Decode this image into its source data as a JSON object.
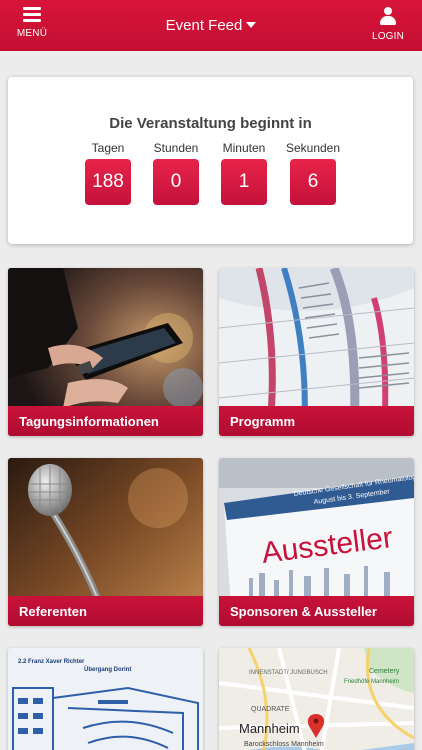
{
  "header": {
    "menu_label": "MENÜ",
    "title": "Event Feed",
    "login_label": "LOGIN"
  },
  "countdown": {
    "title": "Die Veranstaltung beginnt in",
    "units": [
      {
        "label": "Tagen",
        "value": "188"
      },
      {
        "label": "Stunden",
        "value": "0"
      },
      {
        "label": "Minuten",
        "value": "1"
      },
      {
        "label": "Sekunden",
        "value": "6"
      }
    ]
  },
  "tiles": [
    {
      "label": "Tagungsinformationen",
      "icon": "tablet-photo"
    },
    {
      "label": "Programm",
      "icon": "program-photo"
    },
    {
      "label": "Referenten",
      "icon": "microphone-photo"
    },
    {
      "label": "Sponsoren & Aussteller",
      "icon": "exhibitor-photo"
    },
    {
      "label": "",
      "icon": "floorplan-photo"
    },
    {
      "label": "",
      "icon": "map-photo"
    }
  ],
  "decor": {
    "exhibitor_sign_text": "Aussteller",
    "exhibitor_banner_line1": "Deutsche Gesellschaft für Rheumatologie",
    "exhibitor_banner_line2": "August bis 3. September",
    "floorplan_label1": "2.2 Franz Xaver Richter",
    "floorplan_label2": "Übergang Dorint",
    "map_city": "Mannheim",
    "map_district1": "INNENSTADT/ JUNGBUSCH",
    "map_district2": "QUADRATE",
    "map_cemetery": "Cemetery",
    "map_cemetery2": "Friedhöfe Mannheim",
    "map_castle": "Barockschloss Mannheim"
  },
  "colors": {
    "accent": "#c8123a",
    "background": "#ececec"
  }
}
